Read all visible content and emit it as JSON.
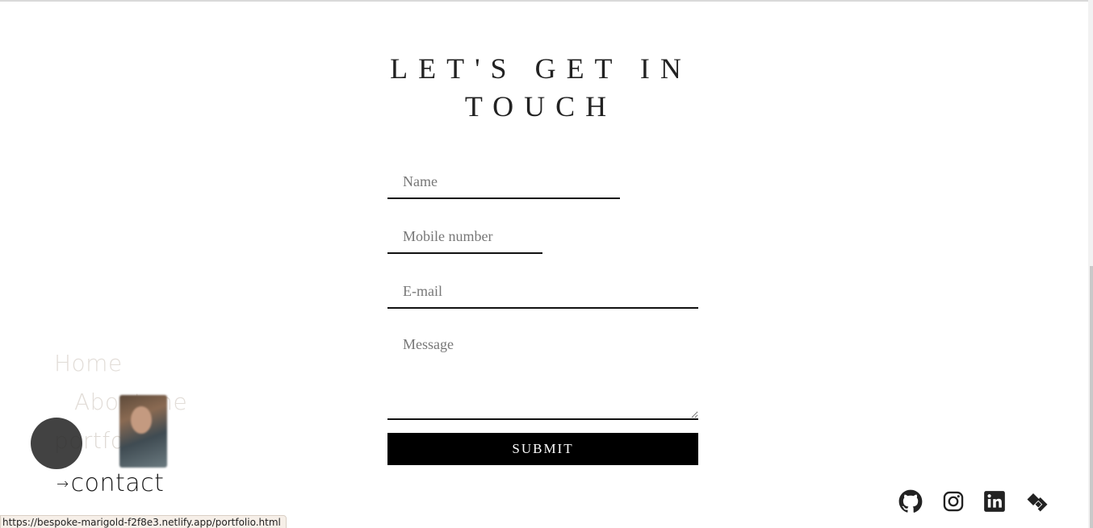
{
  "heading": {
    "line1": "LET'S GET IN",
    "line2": "TOUCH"
  },
  "form": {
    "name_placeholder": "Name",
    "mobile_placeholder": "Mobile number",
    "email_placeholder": "E-mail",
    "message_placeholder": "Message",
    "submit_label": "SUBMIT"
  },
  "nav": {
    "home": "Home",
    "about": "About me",
    "portfolio": "portfolio",
    "contact_arrow": "→",
    "contact": "contact"
  },
  "social": {
    "icons": [
      "github-icon",
      "instagram-icon",
      "linkedin-icon",
      "diamond-logo-icon"
    ]
  },
  "status_bar": {
    "url": "https://bespoke-marigold-f2f8e3.netlify.app/portfolio.html"
  }
}
